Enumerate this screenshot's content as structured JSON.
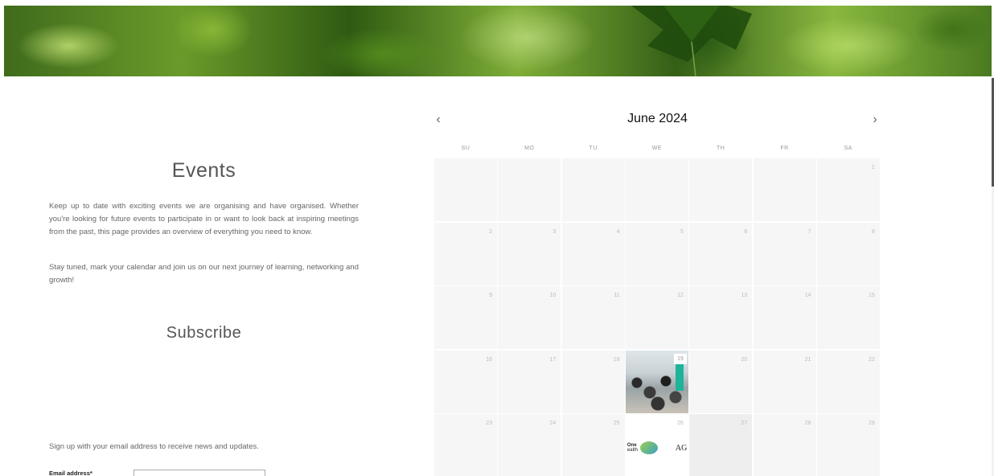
{
  "events": {
    "title": "Events",
    "paragraph1": "Keep up to date with exciting events we are organising and have organised. Whether you're looking for future events to participate in or want to look back at inspiring meetings from the past, this page provides an overview of everything you need to know.",
    "paragraph2": "Stay tuned, mark your calendar and join us on our next journey of learning, networking and growth!"
  },
  "subscribe": {
    "title": "Subscribe",
    "signup_text": "Sign up with your email address to receive news and updates.",
    "email_label": "Email address*"
  },
  "calendar": {
    "title": "June 2024",
    "prev_icon": "chevron-left-icon",
    "next_icon": "chevron-right-icon",
    "weekdays": [
      "SU",
      "MO",
      "TU",
      "WE",
      "TH",
      "FR",
      "SA"
    ],
    "weeks": [
      [
        "",
        "",
        "",
        "",
        "",
        "",
        "1"
      ],
      [
        "2",
        "3",
        "4",
        "5",
        "6",
        "7",
        "8"
      ],
      [
        "9",
        "10",
        "11",
        "12",
        "13",
        "14",
        "15"
      ],
      [
        "16",
        "17",
        "18",
        "19",
        "20",
        "21",
        "22"
      ],
      [
        "23",
        "24",
        "25",
        "26",
        "27",
        "28",
        "29"
      ]
    ],
    "highlighted_day": "27",
    "event_photo_day": "19",
    "event_logo_day": "26",
    "logo_texts": {
      "one": "One",
      "one_sub": "ealth",
      "ag": "AG"
    }
  },
  "colors": {
    "cell_bg": "#f6f6f6",
    "cell_dim": "#eeeeee",
    "text": "#555555"
  }
}
